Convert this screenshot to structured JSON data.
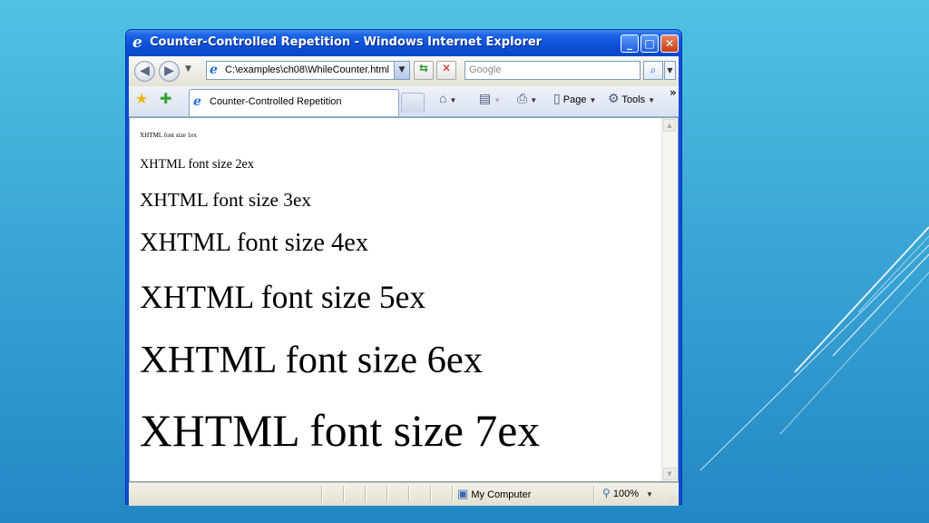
{
  "window": {
    "title": "Counter-Controlled Repetition - Windows Internet Explorer",
    "controls": {
      "minimize": "_",
      "maximize": "□",
      "close": "✕"
    }
  },
  "address_bar": {
    "url": "C:\\examples\\ch08\\WhileCounter.html"
  },
  "search": {
    "placeholder": "Google"
  },
  "tab": {
    "label": "Counter-Controlled Repetition"
  },
  "toolbar": {
    "page_label": "Page",
    "tools_label": "Tools"
  },
  "content": {
    "lines": [
      {
        "text": "XHTML font size 1ex",
        "size_ex": 1
      },
      {
        "text": "XHTML font size 2ex",
        "size_ex": 2
      },
      {
        "text": "XHTML font size 3ex",
        "size_ex": 3
      },
      {
        "text": "XHTML font size 4ex",
        "size_ex": 4
      },
      {
        "text": "XHTML font size 5ex",
        "size_ex": 5
      },
      {
        "text": "XHTML font size 6ex",
        "size_ex": 6
      },
      {
        "text": "XHTML font size 7ex",
        "size_ex": 7
      }
    ]
  },
  "status_bar": {
    "zone": "My Computer",
    "zoom": "100%"
  }
}
